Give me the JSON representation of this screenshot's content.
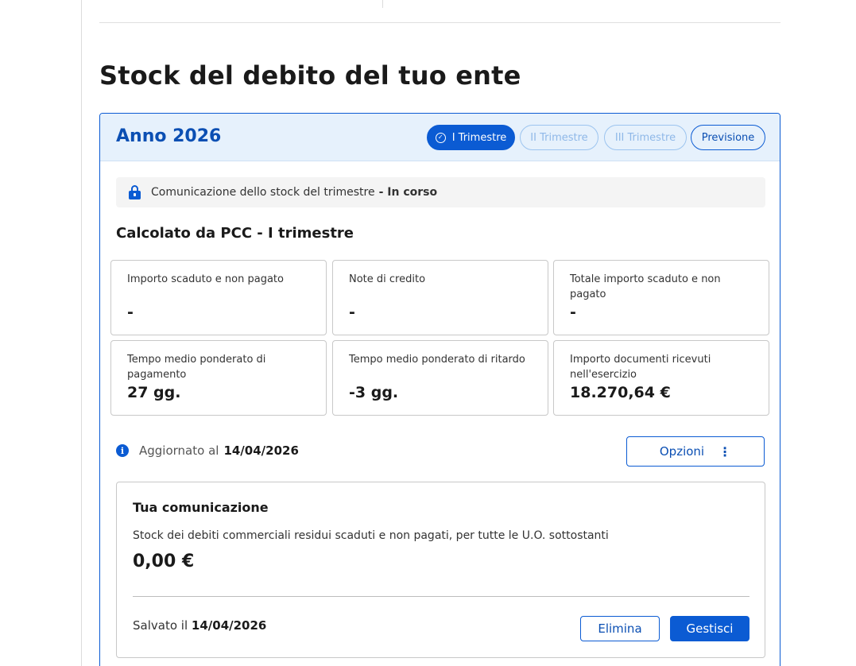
{
  "page": {
    "title": "Stock del debito del tuo ente"
  },
  "year_card": {
    "year_label": "Anno 2026",
    "tabs": [
      {
        "label": "I Trimestre",
        "state": "active"
      },
      {
        "label": "II Trimestre",
        "state": "disabled"
      },
      {
        "label": "III Trimestre",
        "state": "disabled"
      },
      {
        "label": "Previsione",
        "state": "enabled"
      }
    ]
  },
  "notice": {
    "text": "Comunicazione dello stock del trimestre",
    "status": "- In corso",
    "icon": "lock-icon"
  },
  "calc": {
    "title": "Calcolato da PCC - I trimestre",
    "stats": [
      {
        "label": "Importo scaduto e non pagato",
        "value": "-"
      },
      {
        "label": "Note di credito",
        "value": "-"
      },
      {
        "label": "Totale importo scaduto e non pagato",
        "value": "-"
      },
      {
        "label": "Tempo medio ponderato di pagamento",
        "value": "27 gg."
      },
      {
        "label": "Tempo medio ponderato di ritardo",
        "value": "-3 gg."
      },
      {
        "label": "Importo documenti ricevuti nell'esercizio",
        "value": "18.270,64 €"
      }
    ]
  },
  "updated": {
    "prefix": "Aggiornato al",
    "date": "14/04/2026",
    "icon": "info-icon"
  },
  "options": {
    "label": "Opzioni",
    "icon": "more-vertical-icon"
  },
  "communication": {
    "title": "Tua comunicazione",
    "description": "Stock dei debiti commerciali residui scaduti e non pagati, per tutte le U.O. sottostanti",
    "amount": "0,00 €",
    "saved_prefix": "Salvato il",
    "saved_date": "14/04/2026",
    "delete_label": "Elimina",
    "manage_label": "Gestisci"
  },
  "colors": {
    "primary": "#0b5bd3",
    "header_bg": "#e6f1fc",
    "disabled": "#8fb8e8"
  }
}
